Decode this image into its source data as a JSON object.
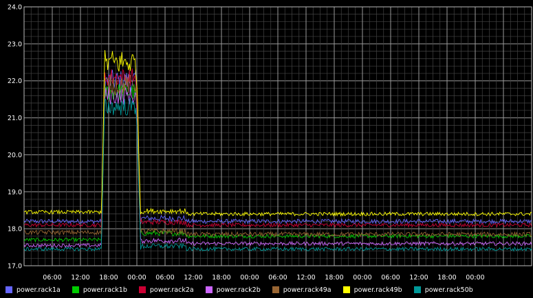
{
  "chart_data": {
    "type": "line",
    "title": "",
    "xlabel": "",
    "ylabel": "",
    "ylim": [
      17.0,
      24.0
    ],
    "y_ticks": [
      "17.0",
      "18.0",
      "19.0",
      "20.0",
      "21.0",
      "22.0",
      "23.0",
      "24.0"
    ],
    "x_tick_labels": [
      "06:00",
      "12:00",
      "18:00",
      "00:00",
      "06:00",
      "12:00",
      "18:00",
      "00:00",
      "06:00",
      "12:00",
      "18:00",
      "00:00",
      "06:00",
      "12:00",
      "18:00",
      "00:00"
    ],
    "x_hours_range": [
      0,
      108
    ],
    "x_tick_hours": [
      6,
      12,
      18,
      24,
      30,
      36,
      42,
      48,
      54,
      60,
      66,
      72,
      78,
      84,
      90,
      96
    ],
    "grid": true,
    "legend_position": "bottom",
    "background_color": "#000000",
    "grid_color": "#777777",
    "series": [
      {
        "name": "power.rack1a",
        "color": "#6666ff",
        "baseline": 18.2,
        "peak": 22.0,
        "after": 18.2,
        "noise": 0.06,
        "peak_noise": 0.3
      },
      {
        "name": "power.rack1b",
        "color": "#00cc00",
        "baseline": 17.7,
        "peak": 21.7,
        "after": 17.8,
        "noise": 0.05,
        "peak_noise": 0.25
      },
      {
        "name": "power.rack2a",
        "color": "#cc0033",
        "baseline": 18.1,
        "peak": 22.1,
        "after": 18.1,
        "noise": 0.05,
        "peak_noise": 0.25
      },
      {
        "name": "power.rack2b",
        "color": "#cc66ff",
        "baseline": 17.55,
        "peak": 21.6,
        "after": 17.6,
        "noise": 0.05,
        "peak_noise": 0.25
      },
      {
        "name": "power.rack49a",
        "color": "#996633",
        "baseline": 17.9,
        "peak": 21.9,
        "after": 17.85,
        "noise": 0.06,
        "peak_noise": 0.28
      },
      {
        "name": "power.rack49b",
        "color": "#ffff00",
        "baseline": 18.45,
        "peak": 22.5,
        "after": 18.4,
        "noise": 0.05,
        "peak_noise": 0.35
      },
      {
        "name": "power.rack50b",
        "color": "#009999",
        "baseline": 17.45,
        "peak": 21.3,
        "after": 17.45,
        "noise": 0.05,
        "peak_noise": 0.25
      }
    ],
    "peak_start_hour": 16.5,
    "peak_end_hour": 24.5
  }
}
